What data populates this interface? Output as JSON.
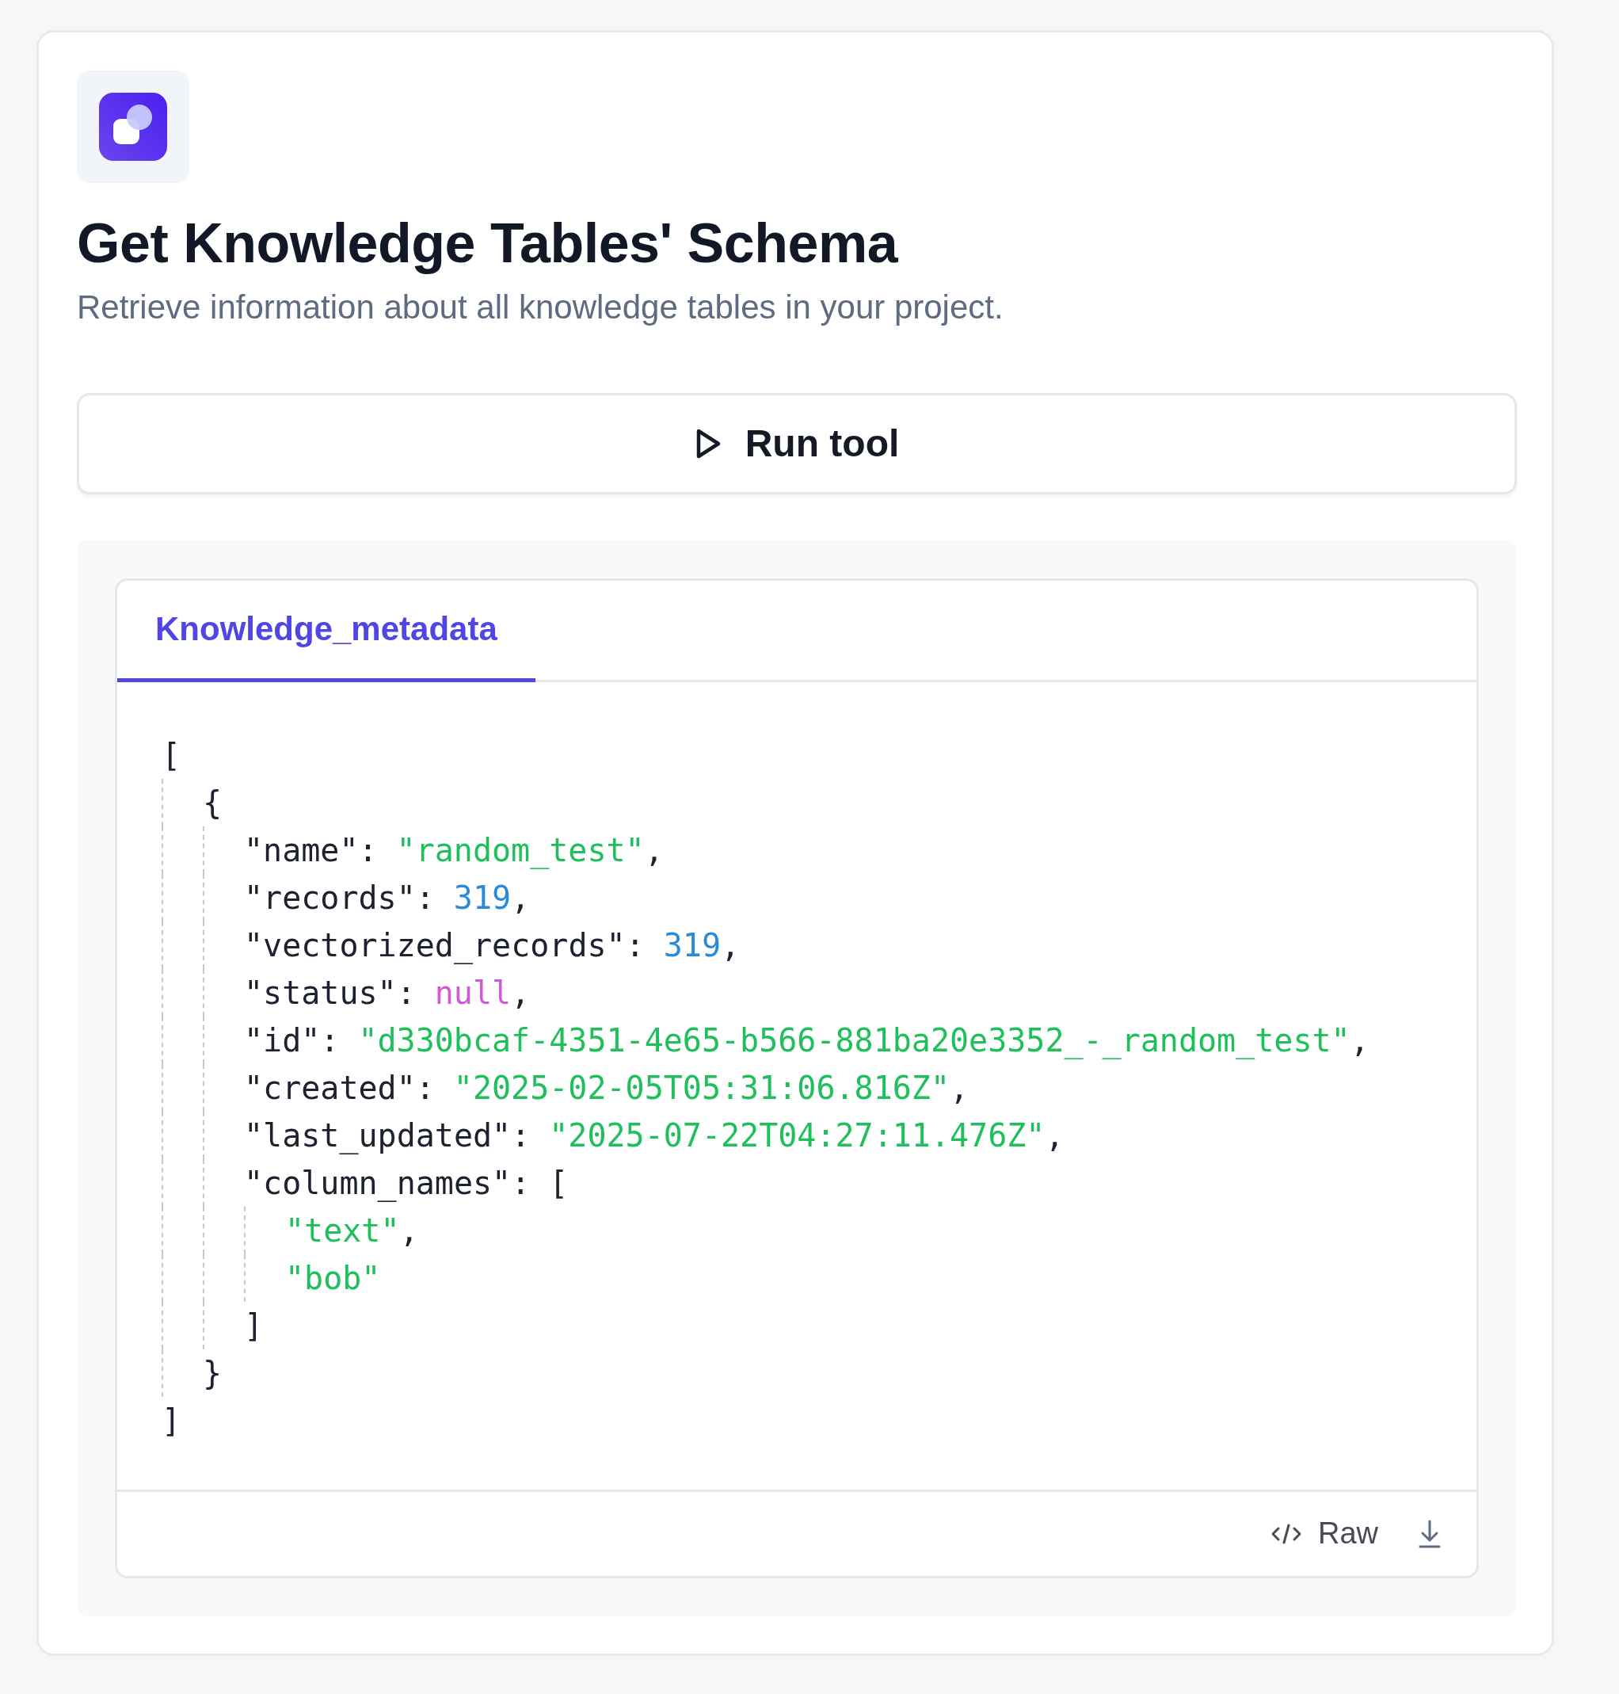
{
  "tool": {
    "title": "Get Knowledge Tables' Schema",
    "description": "Retrieve information about all knowledge tables in your project."
  },
  "run_button": {
    "label": "Run tool"
  },
  "result": {
    "tabs": [
      {
        "label": "Knowledge_metadata",
        "selected": true
      }
    ],
    "code": {
      "open": "[",
      "close": "]",
      "children": [
        {
          "open": "{",
          "close": "}",
          "children": [
            {
              "key": "\"name\"",
              "sep": ":",
              "value": "\"random_test\"",
              "kind": "string",
              "comma": ","
            },
            {
              "key": "\"records\"",
              "sep": ":",
              "value": "319",
              "kind": "number",
              "comma": ","
            },
            {
              "key": "\"vectorized_records\"",
              "sep": ":",
              "value": "319",
              "kind": "number",
              "comma": ","
            },
            {
              "key": "\"status\"",
              "sep": ":",
              "value": "null",
              "kind": "null",
              "comma": ","
            },
            {
              "key": "\"id\"",
              "sep": ":",
              "value": "\"d330bcaf-4351-4e65-b566-881ba20e3352_-_random_test\"",
              "kind": "string",
              "comma": ","
            },
            {
              "key": "\"created\"",
              "sep": ":",
              "value": "\"2025-02-05T05:31:06.816Z\"",
              "kind": "string",
              "comma": ","
            },
            {
              "key": "\"last_updated\"",
              "sep": ":",
              "value": "\"2025-07-22T04:27:11.476Z\"",
              "kind": "string",
              "comma": ","
            },
            {
              "key": "\"column_names\"",
              "sep": ":",
              "open": "[",
              "close": "]",
              "children": [
                {
                  "value": "\"text\"",
                  "kind": "string",
                  "comma": ","
                },
                {
                  "value": "\"bob\"",
                  "kind": "string"
                }
              ]
            }
          ]
        }
      ]
    },
    "footer": {
      "raw_label": "Raw"
    }
  }
}
